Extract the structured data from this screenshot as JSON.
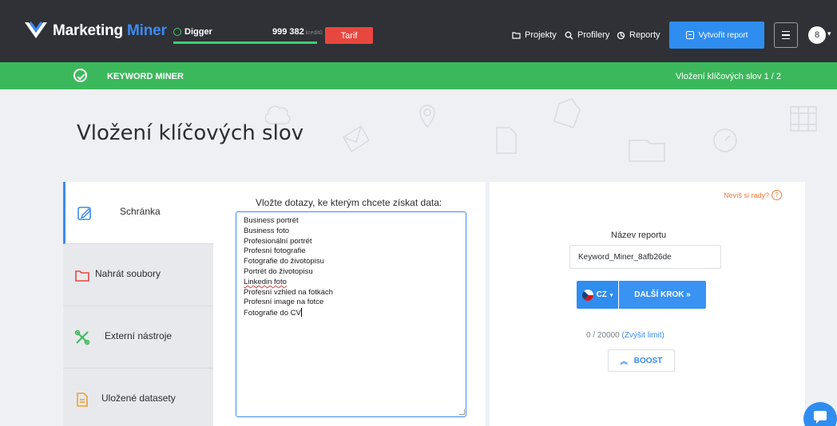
{
  "header": {
    "logo": {
      "word1": "Marketing",
      "word2": "Miner"
    },
    "plan_name": "Digger",
    "credits": "999 382",
    "credits_unit": "kreditů",
    "tarif_label": "Tarif",
    "nav": [
      {
        "label": "Projekty",
        "icon": "folder-icon"
      },
      {
        "label": "Profilery",
        "icon": "search-icon"
      },
      {
        "label": "Reporty",
        "icon": "report-icon"
      }
    ],
    "create_report_label": "Vytvořit report",
    "avatar_initial": "8"
  },
  "subbar": {
    "tool_name": "KEYWORD MINER",
    "step": "Vložení klíčových slov 1 / 2"
  },
  "page": {
    "title": "Vložení klíčových slov"
  },
  "tabs": [
    {
      "label": "Schránka",
      "icon": "edit-icon",
      "active": true
    },
    {
      "label": "Nahrát soubory",
      "icon": "folder-icon",
      "active": false
    },
    {
      "label": "Externí nástroje",
      "icon": "tools-icon",
      "active": false
    },
    {
      "label": "Uložené datasety",
      "icon": "document-icon",
      "active": false
    }
  ],
  "input_panel": {
    "label": "Vložte dotazy, ke kterým chcete získat data:",
    "keywords": [
      "Business portrét",
      "Business foto",
      "Profesionální portrét",
      "Profesní fotografie",
      "Fotografie do životopisu",
      "Portrét do životopisu",
      "Linkedin foto",
      "Profesní vzhled na fotkách",
      "Profesní image na fotce",
      "Fotografie do CV"
    ]
  },
  "report_panel": {
    "help_label": "Nevíš si rady?",
    "report_name_label": "Název reportu",
    "report_name_value": "Keyword_Miner_8afb26de",
    "language": "CZ",
    "next_label": "DALŠÍ KROK »",
    "limit_text": "0 / 20000",
    "limit_link": "(Zvýšit limit)",
    "boost_label": "BOOST"
  },
  "colors": {
    "topbar": "#2f3136",
    "green": "#3cb85c",
    "accent_blue": "#2f8df0",
    "tarif_red": "#e8473f",
    "help_orange": "#f07a3a"
  }
}
